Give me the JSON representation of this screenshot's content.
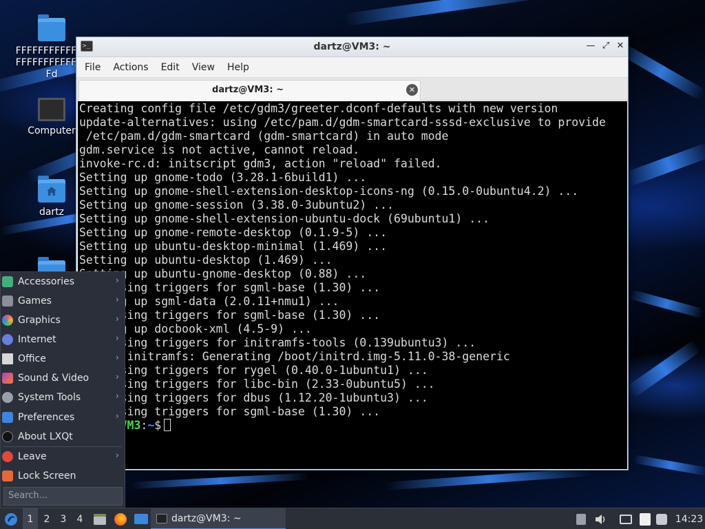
{
  "desktop": {
    "icons": [
      {
        "label": "FFFFFFFFFFFFFFFFFFFFFFFFFFFd"
      },
      {
        "label": "Computer"
      },
      {
        "label": "dartz"
      }
    ]
  },
  "terminal_window": {
    "title": "dartz@VM3: ~",
    "controls": {
      "minimize": "—",
      "maximize": "⤢",
      "close": "✕"
    },
    "menu": [
      "File",
      "Actions",
      "Edit",
      "View",
      "Help"
    ],
    "tab": {
      "label": "dartz@VM3: ~",
      "close": "✕"
    },
    "lines": [
      "Creating config file /etc/gdm3/greeter.dconf-defaults with new version",
      "update-alternatives: using /etc/pam.d/gdm-smartcard-sssd-exclusive to provide",
      " /etc/pam.d/gdm-smartcard (gdm-smartcard) in auto mode",
      "gdm.service is not active, cannot reload.",
      "invoke-rc.d: initscript gdm3, action \"reload\" failed.",
      "Setting up gnome-todo (3.28.1-6build1) ...",
      "Setting up gnome-shell-extension-desktop-icons-ng (0.15.0-0ubuntu4.2) ...",
      "Setting up gnome-session (3.38.0-3ubuntu2) ...",
      "Setting up gnome-shell-extension-ubuntu-dock (69ubuntu1) ...",
      "Setting up gnome-remote-desktop (0.1.9-5) ...",
      "Setting up ubuntu-desktop-minimal (1.469) ...",
      "Setting up ubuntu-desktop (1.469) ...",
      "Setting up ubuntu-gnome-desktop (0.88) ...",
      "Processing triggers for sgml-base (1.30) ...",
      "Setting up sgml-data (2.0.11+nmu1) ...",
      "Processing triggers for sgml-base (1.30) ...",
      "Setting up docbook-xml (4.5-9) ...",
      "Processing triggers for initramfs-tools (0.139ubuntu3) ...",
      "update-initramfs: Generating /boot/initrd.img-5.11.0-38-generic",
      "Processing triggers for rygel (0.40.0-1ubuntu1) ...",
      "Processing triggers for libc-bin (2.33-0ubuntu5) ...",
      "Processing triggers for dbus (1.12.20-1ubuntu3) ...",
      "Processing triggers for sgml-base (1.30) ..."
    ],
    "prompt": {
      "user": "dartz@VM3",
      "sep": ":",
      "path": "~",
      "symbol": "$"
    }
  },
  "start_menu": {
    "items": [
      {
        "label": "Accessories",
        "icon": "accessories-icon",
        "color": "#3fb07a",
        "submenu": true
      },
      {
        "label": "Games",
        "icon": "games-icon",
        "color": "#8a8f99",
        "submenu": true
      },
      {
        "label": "Graphics",
        "icon": "graphics-icon",
        "color": "#e05a8a",
        "submenu": true
      },
      {
        "label": "Internet",
        "icon": "internet-icon",
        "color": "#6a7de0",
        "submenu": true
      },
      {
        "label": "Office",
        "icon": "office-icon",
        "color": "#d8d8d8",
        "submenu": true
      },
      {
        "label": "Sound & Video",
        "icon": "sound-video-icon",
        "color": "#b040c0",
        "submenu": true
      },
      {
        "label": "System Tools",
        "icon": "system-tools-icon",
        "color": "#9aa0aa",
        "submenu": true
      },
      {
        "label": "Preferences",
        "icon": "preferences-icon",
        "color": "#3a86e0",
        "submenu": true
      },
      {
        "label": "About LXQt",
        "icon": "about-icon",
        "color": "#1a1a1a",
        "submenu": false
      },
      {
        "label": "Leave",
        "icon": "leave-icon",
        "color": "#e04a3a",
        "submenu": true
      },
      {
        "label": "Lock Screen",
        "icon": "lock-icon",
        "color": "#e06a3a",
        "submenu": false
      }
    ],
    "search_placeholder": "Search..."
  },
  "taskbar": {
    "desktops": [
      "1",
      "2",
      "3",
      "4"
    ],
    "active_desktop": "1",
    "task": {
      "label": "dartz@VM3: ~"
    },
    "clock": "14:23"
  }
}
